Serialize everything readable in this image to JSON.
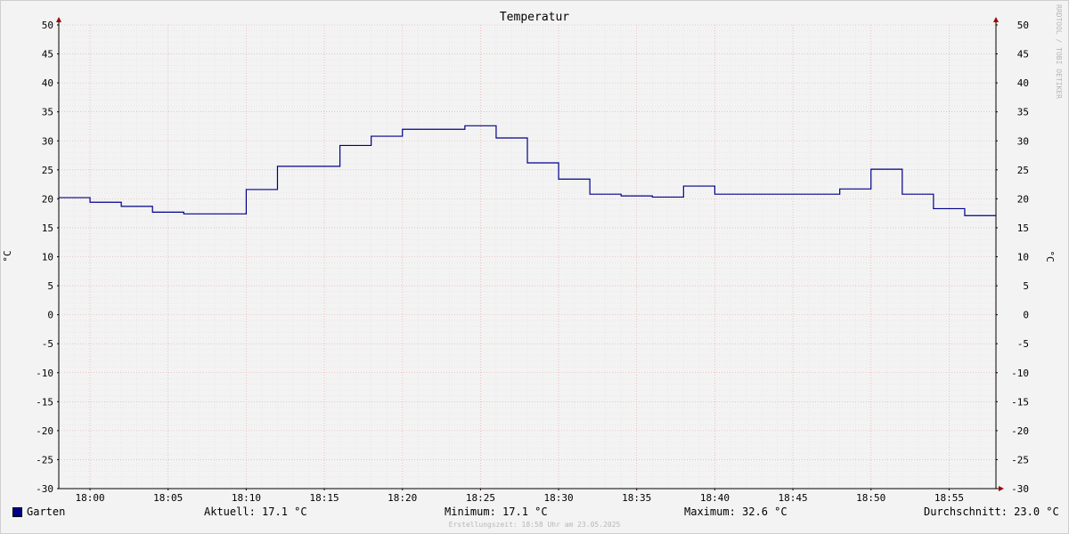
{
  "chart_data": {
    "type": "line",
    "title": "Temperatur",
    "ylabel_left": "°C",
    "ylabel_right": "°C",
    "ylim": [
      -30,
      50
    ],
    "y_ticks": [
      "50",
      "45",
      "40",
      "35",
      "30",
      "25",
      "20",
      "15",
      "10",
      "5",
      "0",
      "-5",
      "-10",
      "-15",
      "-20",
      "-25",
      "-30"
    ],
    "x_ticks": [
      "18:00",
      "18:05",
      "18:10",
      "18:15",
      "18:20",
      "18:25",
      "18:30",
      "18:35",
      "18:40",
      "18:45",
      "18:50",
      "18:55"
    ],
    "x_range": [
      "17:58",
      "18:58"
    ],
    "grid": true,
    "step_style": "step",
    "series": [
      {
        "name": "Garten",
        "color": "#00008b",
        "points": [
          {
            "t": "17:58",
            "v": 20.2
          },
          {
            "t": "18:00",
            "v": 19.4
          },
          {
            "t": "18:02",
            "v": 18.7
          },
          {
            "t": "18:04",
            "v": 17.7
          },
          {
            "t": "18:06",
            "v": 17.4
          },
          {
            "t": "18:10",
            "v": 21.6
          },
          {
            "t": "18:12",
            "v": 25.6
          },
          {
            "t": "18:16",
            "v": 29.2
          },
          {
            "t": "18:18",
            "v": 30.8
          },
          {
            "t": "18:20",
            "v": 32.0
          },
          {
            "t": "18:24",
            "v": 32.6
          },
          {
            "t": "18:26",
            "v": 30.5
          },
          {
            "t": "18:28",
            "v": 26.2
          },
          {
            "t": "18:30",
            "v": 23.4
          },
          {
            "t": "18:32",
            "v": 20.8
          },
          {
            "t": "18:34",
            "v": 20.5
          },
          {
            "t": "18:36",
            "v": 20.3
          },
          {
            "t": "18:38",
            "v": 22.2
          },
          {
            "t": "18:40",
            "v": 20.8
          },
          {
            "t": "18:48",
            "v": 21.7
          },
          {
            "t": "18:50",
            "v": 25.1
          },
          {
            "t": "18:52",
            "v": 20.8
          },
          {
            "t": "18:54",
            "v": 18.3
          },
          {
            "t": "18:56",
            "v": 17.1
          },
          {
            "t": "18:58",
            "v": 17.1
          }
        ]
      }
    ]
  },
  "legend": {
    "series_name": "Garten",
    "swatch_color": "#00008b",
    "current": "Aktuell: 17.1 °C",
    "minimum": "Minimum: 17.1 °C",
    "maximum": "Maximum: 32.6 °C",
    "average": "Durchschnitt: 23.0 °C"
  },
  "footer": {
    "created": "Erstellungszeit: 18:58 Uhr am 23.05.2025",
    "watermark": "RRDTOOL / TOBI OETIKER"
  }
}
